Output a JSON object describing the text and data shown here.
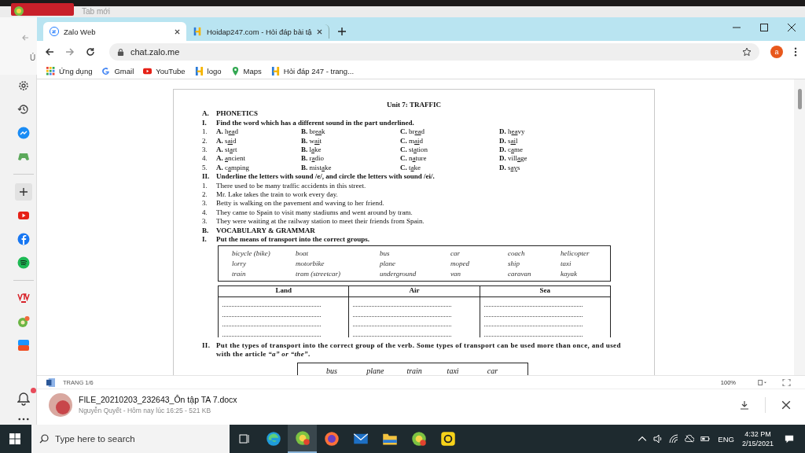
{
  "back_window": {
    "tab_title": "Tab mới",
    "bookmark_fragment": "Ú"
  },
  "browser": {
    "tabs": [
      {
        "title": "Zalo Web",
        "kind": "zalo",
        "selected": true
      },
      {
        "title": "Hoidap247.com - Hỏi đáp bài tậ",
        "kind": "h",
        "selected": false
      }
    ],
    "url": "chat.zalo.me",
    "profile_initial": "a",
    "bookmarks": [
      {
        "label": "Ứng dụng",
        "kind": "apps"
      },
      {
        "label": "Gmail",
        "kind": "google"
      },
      {
        "label": "YouTube",
        "kind": "youtube"
      },
      {
        "label": "logo",
        "kind": "h"
      },
      {
        "label": "Maps",
        "kind": "maps"
      },
      {
        "label": "Hỏi đáp 247 - trang...",
        "kind": "h"
      }
    ]
  },
  "sidebar": {
    "items": [
      {
        "kind": "settings"
      },
      {
        "kind": "history"
      },
      {
        "kind": "messenger"
      },
      {
        "kind": "game"
      },
      {
        "kind": "divider"
      },
      {
        "kind": "add"
      },
      {
        "kind": "youtube"
      },
      {
        "kind": "facebook"
      },
      {
        "kind": "spotify"
      },
      {
        "kind": "divider"
      },
      {
        "kind": "vtv"
      },
      {
        "kind": "chat"
      },
      {
        "kind": "tiki"
      }
    ],
    "bell_unread": true
  },
  "document": {
    "title": "Unit 7: TRAFFIC",
    "part_a": {
      "number": "A.",
      "heading": "PHONETICS"
    },
    "exercise_1": {
      "number": "I.",
      "instruction": "Find the word which has a different sound in the part underlined.",
      "questions": [
        {
          "number": "1.",
          "options": [
            {
              "letter": "A.",
              "before": "h",
              "underlined": "ea",
              "after": "d"
            },
            {
              "letter": "B.",
              "before": "br",
              "underlined": "ea",
              "after": "k"
            },
            {
              "letter": "C.",
              "before": "br",
              "underlined": "ea",
              "after": "d"
            },
            {
              "letter": "D.",
              "before": "h",
              "underlined": "ea",
              "after": "vy"
            }
          ]
        },
        {
          "number": "2.",
          "options": [
            {
              "letter": "A.",
              "before": "s",
              "underlined": "ai",
              "after": "d"
            },
            {
              "letter": "B.",
              "before": "w",
              "underlined": "ai",
              "after": "t"
            },
            {
              "letter": "C.",
              "before": "m",
              "underlined": "ai",
              "after": "d"
            },
            {
              "letter": "D.",
              "before": "s",
              "underlined": "ai",
              "after": "l"
            }
          ]
        },
        {
          "number": "3.",
          "options": [
            {
              "letter": "A.",
              "before": "st",
              "underlined": "a",
              "after": "rt"
            },
            {
              "letter": "B.",
              "before": "l",
              "underlined": "a",
              "after": "ke"
            },
            {
              "letter": "C.",
              "before": "st",
              "underlined": "a",
              "after": "tion"
            },
            {
              "letter": "D.",
              "before": "c",
              "underlined": "a",
              "after": "me"
            }
          ]
        },
        {
          "number": "4.",
          "options": [
            {
              "letter": "A.",
              "underlined": "a",
              "after": "ncient"
            },
            {
              "letter": "B.",
              "before": "r",
              "underlined": "a",
              "after": "dio"
            },
            {
              "letter": "C.",
              "before": "n",
              "underlined": "a",
              "after": "ture"
            },
            {
              "letter": "D.",
              "before": "vill",
              "underlined": "a",
              "after": "ge"
            }
          ]
        },
        {
          "number": "5.",
          "options": [
            {
              "letter": "A.",
              "before": "c",
              "underlined": "a",
              "after": "mping"
            },
            {
              "letter": "B.",
              "before": "mist",
              "underlined": "a",
              "after": "ke"
            },
            {
              "letter": "C.",
              "before": "t",
              "underlined": "a",
              "after": "ke"
            },
            {
              "letter": "D.",
              "before": "s",
              "underlined": "ay",
              "after": "s"
            }
          ]
        }
      ]
    },
    "exercise_2": {
      "number": "II.",
      "instruction": "Underline the letters with sound /e/, and circle the letters with sound /ei/.",
      "sentences": [
        {
          "number": "1.",
          "text": "There used to be many traffic accidents in this street."
        },
        {
          "number": "2.",
          "text": "Mr. Lake takes the train to work every day."
        },
        {
          "number": "3.",
          "text": "Betty is walking on the pavement and waving to her friend."
        },
        {
          "number": "4.",
          "text": "They came to Spain to visit many stadiums and went around by tram."
        },
        {
          "number": "3.",
          "text": "They were waiting at the railway station to meet their friends from Spain."
        }
      ]
    },
    "part_b": {
      "number": "B.",
      "heading": "VOCABULARY & GRAMMAR"
    },
    "exercise_3": {
      "number": "I.",
      "instruction": "Put the means of transport into the correct groups.",
      "word_box": [
        [
          "bicycle (bike)",
          "boat",
          "bus",
          "car",
          "coach",
          "helicopter"
        ],
        [
          "lorry",
          "motorbike",
          "plane",
          "moped",
          "ship",
          "taxi"
        ],
        [
          "train",
          "tram (streetcar)",
          "underground",
          "van",
          "caravan",
          "kayak"
        ]
      ],
      "groups": [
        {
          "heading": "Land"
        },
        {
          "heading": "Air"
        },
        {
          "heading": "Sea"
        }
      ]
    },
    "exercise_4": {
      "number": "II.",
      "instruction": "Put the types of transport into the correct group of the verb. Some types of transport can be used more than once, and used with the article *“a” or “the”*.",
      "word_box": [
        "bus",
        "plane",
        "train",
        "taxi",
        "car"
      ]
    }
  },
  "viewer": {
    "page_indicator": "TRANG 1/6",
    "zoom": "100%"
  },
  "file": {
    "name": "FILE_20210203_232643_Ôn tập TA 7.docx",
    "meta": "Nguyễn Quyết - Hôm nay lúc 16:25 - 521 KB"
  },
  "taskbar": {
    "search_placeholder": "Type here to search",
    "apps": [
      {
        "kind": "taskview",
        "active": false
      },
      {
        "kind": "edge",
        "active": false
      },
      {
        "kind": "coccoc",
        "active": true
      },
      {
        "kind": "firefox",
        "active": false
      },
      {
        "kind": "mail",
        "active": false
      },
      {
        "kind": "explorer",
        "active": false
      },
      {
        "kind": "coccoc",
        "active": false
      },
      {
        "kind": "yellow",
        "active": false
      }
    ],
    "language": "ENG",
    "time": "4:32 PM",
    "date": "2/15/2021"
  }
}
